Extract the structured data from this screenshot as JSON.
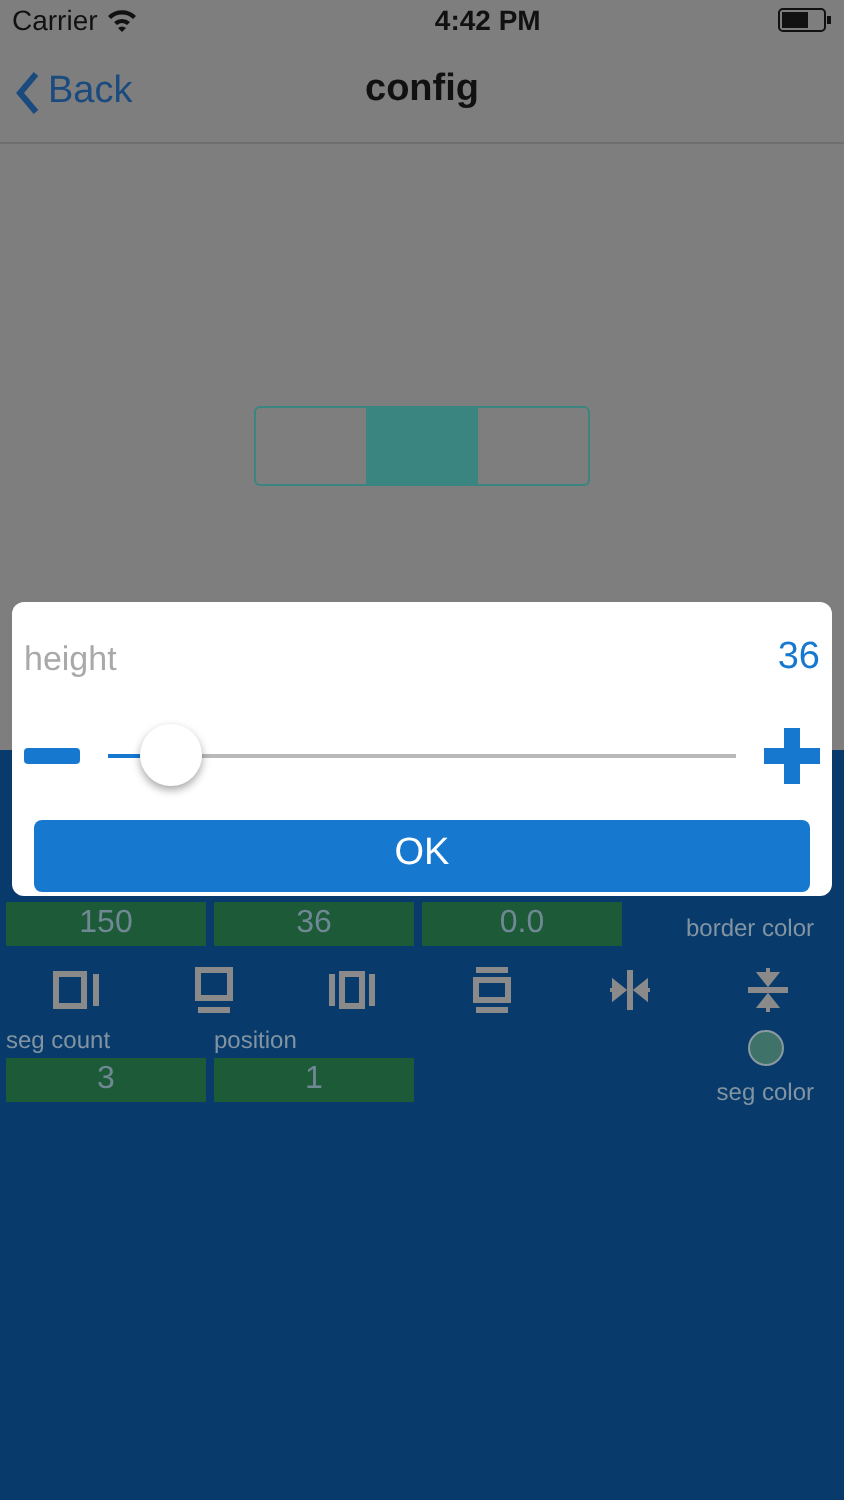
{
  "status_bar": {
    "carrier": "Carrier",
    "time": "4:42 PM"
  },
  "nav": {
    "back": "Back",
    "title": "config"
  },
  "preview": {
    "segments": [
      {
        "filled": false
      },
      {
        "filled": true
      },
      {
        "filled": false
      }
    ]
  },
  "panel": {
    "values": [
      "150",
      "36",
      "0.0"
    ],
    "border_color_label": "border color",
    "fields": [
      {
        "label": "seg count",
        "value": "3"
      },
      {
        "label": "position",
        "value": "1"
      }
    ],
    "seg_color": {
      "label": "seg color",
      "color": "#3f7268"
    }
  },
  "dialog": {
    "label": "height",
    "value": "36",
    "level": 0.1,
    "ok": "OK"
  }
}
